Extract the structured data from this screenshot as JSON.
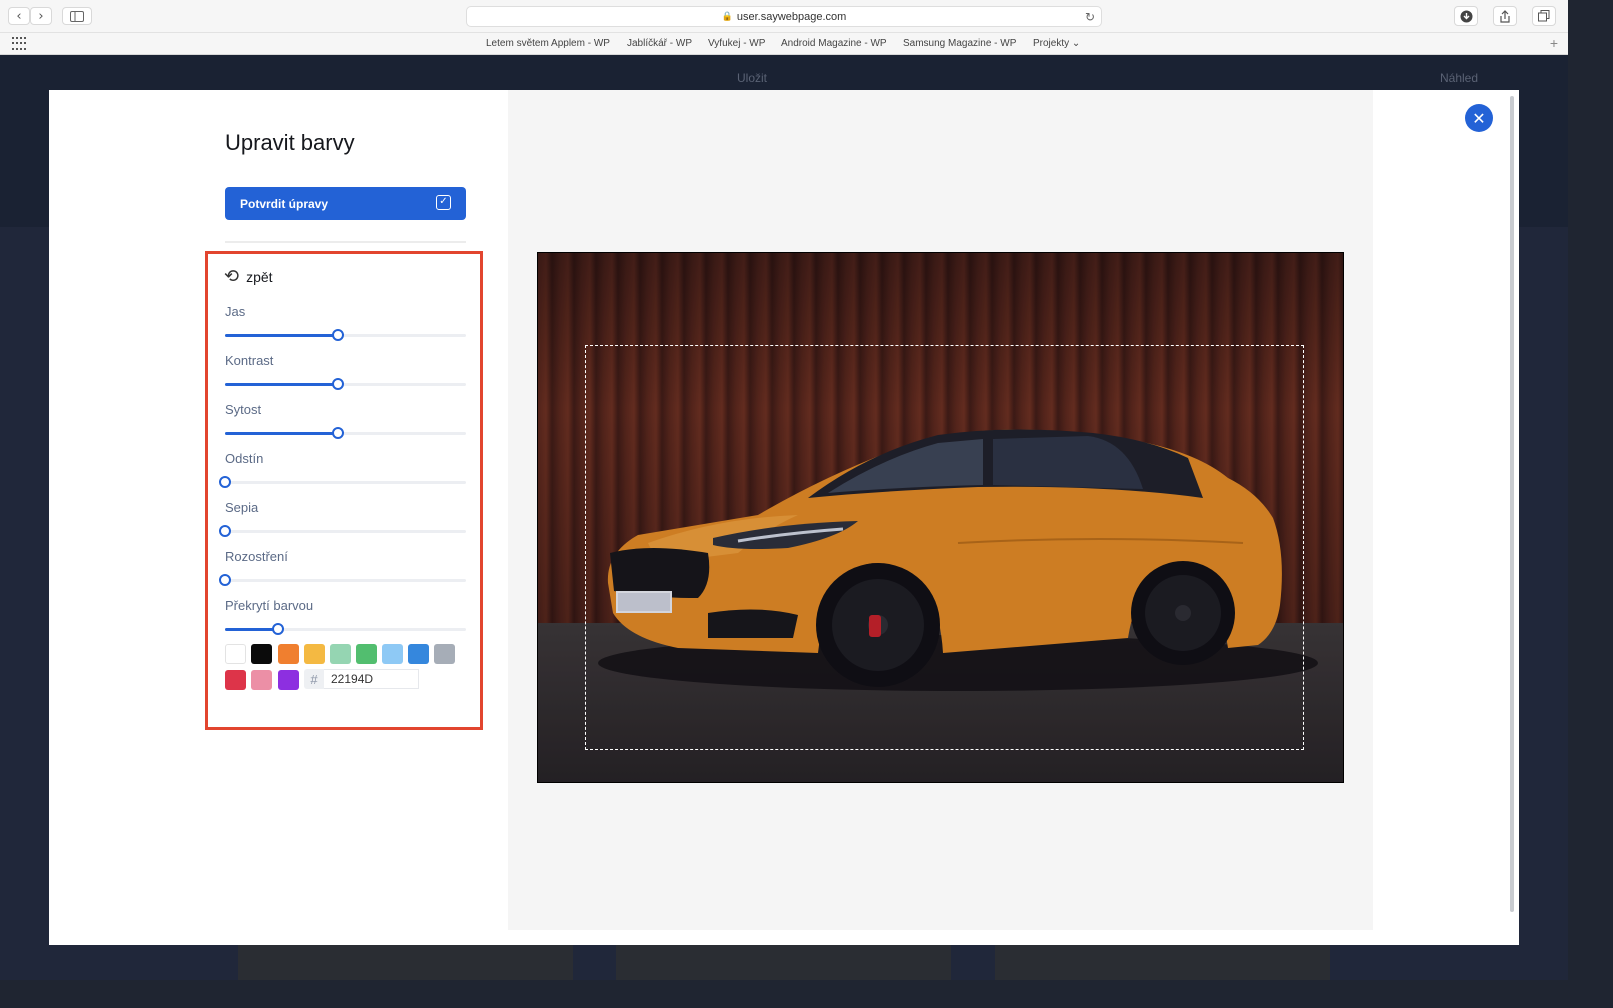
{
  "browser": {
    "url": "user.saywebpage.com",
    "nav_back": "‹",
    "nav_forward": "›",
    "bookmarks": [
      "Letem světem Applem - WP",
      "Jablíčkář - WP",
      "Vyfukej - WP",
      "Android Magazine - WP",
      "Samsung Magazine - WP",
      "Projekty ⌄"
    ]
  },
  "app": {
    "save_label": "Uložit",
    "preview_label": "Náhled"
  },
  "editor": {
    "title": "Upravit barvy",
    "confirm_label": "Potvrdit úpravy",
    "back_label": "zpět",
    "sliders": [
      {
        "label": "Jas",
        "value": 0.47
      },
      {
        "label": "Kontrast",
        "value": 0.47
      },
      {
        "label": "Sytost",
        "value": 0.47
      },
      {
        "label": "Odstín",
        "value": 0.0
      },
      {
        "label": "Sepia",
        "value": 0.0
      },
      {
        "label": "Rozostření",
        "value": 0.0
      },
      {
        "label": "Překrytí barvou",
        "value": 0.22
      }
    ],
    "swatches": [
      "#ffffff",
      "#0b0b0b",
      "#f07f2f",
      "#f4b942",
      "#95d5b2",
      "#52be6f",
      "#8ec9f5",
      "#3587dd",
      "#a6adb7",
      "#dd3449",
      "#ec8fa6",
      "#8d2fe0"
    ],
    "hex_prefix": "#",
    "hex_value": "22194D",
    "overlay_color": "#22194D",
    "accent": "#2362d6",
    "highlight_color": "#e2452f"
  }
}
